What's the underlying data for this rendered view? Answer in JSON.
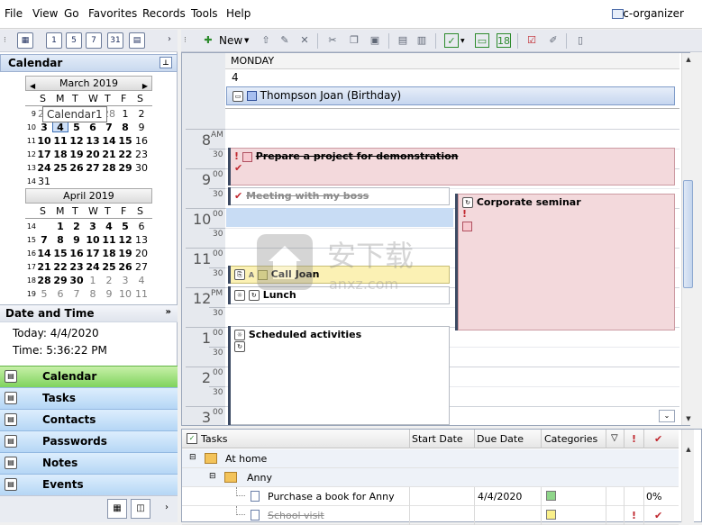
{
  "menu": {
    "file": "File",
    "view": "View",
    "go": "Go",
    "favorites": "Favorites",
    "records": "Records",
    "tools": "Tools",
    "help": "Help",
    "app_name": "c-organizer"
  },
  "left": {
    "header": "Calendar",
    "tooltip": "Calendar1",
    "march": {
      "title": "March 2019",
      "dow": [
        "S",
        "M",
        "T",
        "W",
        "T",
        "F",
        "S"
      ],
      "weeks": [
        {
          "wk": "9",
          "days": [
            "24",
            "25",
            "26",
            "27",
            "28",
            "1",
            "2"
          ]
        },
        {
          "wk": "10",
          "days": [
            "3",
            "4",
            "5",
            "6",
            "7",
            "8",
            "9"
          ]
        },
        {
          "wk": "11",
          "days": [
            "10",
            "11",
            "12",
            "13",
            "14",
            "15",
            "16"
          ]
        },
        {
          "wk": "12",
          "days": [
            "17",
            "18",
            "19",
            "20",
            "21",
            "22",
            "23"
          ]
        },
        {
          "wk": "13",
          "days": [
            "24",
            "25",
            "26",
            "27",
            "28",
            "29",
            "30"
          ]
        },
        {
          "wk": "14",
          "days": [
            "31"
          ]
        }
      ]
    },
    "april": {
      "title": "April 2019",
      "dow": [
        "S",
        "M",
        "T",
        "W",
        "T",
        "F",
        "S"
      ],
      "weeks": [
        {
          "wk": "14",
          "days": [
            "",
            "1",
            "2",
            "3",
            "4",
            "5",
            "6"
          ]
        },
        {
          "wk": "15",
          "days": [
            "7",
            "8",
            "9",
            "10",
            "11",
            "12",
            "13"
          ]
        },
        {
          "wk": "16",
          "days": [
            "14",
            "15",
            "16",
            "17",
            "18",
            "19",
            "20"
          ]
        },
        {
          "wk": "17",
          "days": [
            "21",
            "22",
            "23",
            "24",
            "25",
            "26",
            "27"
          ]
        },
        {
          "wk": "18",
          "days": [
            "28",
            "29",
            "30",
            "1",
            "2",
            "3",
            "4"
          ]
        },
        {
          "wk": "19",
          "days": [
            "5",
            "6",
            "7",
            "8",
            "9",
            "10",
            "11"
          ]
        }
      ]
    },
    "datetime_header": "Date and Time",
    "today": "Today: 4/4/2020",
    "time": "Time: 5:36:22 PM",
    "nav": [
      {
        "label": "Calendar",
        "icon": "calendar-icon"
      },
      {
        "label": "Tasks",
        "icon": "tasks-icon"
      },
      {
        "label": "Contacts",
        "icon": "contacts-icon"
      },
      {
        "label": "Passwords",
        "icon": "passwords-icon"
      },
      {
        "label": "Notes",
        "icon": "notes-icon"
      },
      {
        "label": "Events",
        "icon": "events-icon"
      }
    ]
  },
  "toolbar": {
    "new_label": "New"
  },
  "day": {
    "dayname": "MONDAY",
    "daynum": "4",
    "allday_event": "Thompson Joan (Birthday)",
    "hours": [
      {
        "h": "8",
        "ampm": "AM"
      },
      {
        "h": "9",
        "ampm": ""
      },
      {
        "h": "10",
        "ampm": ""
      },
      {
        "h": "11",
        "ampm": ""
      },
      {
        "h": "12",
        "ampm": "PM"
      },
      {
        "h": "1",
        "ampm": ""
      },
      {
        "h": "2",
        "ampm": ""
      },
      {
        "h": "3",
        "ampm": ""
      }
    ],
    "min_00": "00",
    "min_30": "30",
    "events": {
      "prepare": "Prepare a project for demonstration",
      "meeting": "Meeting with my boss",
      "seminar": "Corporate seminar",
      "call": "Call Joan",
      "lunch": "Lunch",
      "scheduled": "Scheduled activities"
    }
  },
  "tasks": {
    "columns": {
      "tasks": "Tasks",
      "start": "Start Date",
      "due": "Due Date",
      "categories": "Categories"
    },
    "group": "At home",
    "subgroup": "Anny",
    "rows": [
      {
        "name": "Purchase a book for Anny",
        "start": "",
        "due": "4/4/2020",
        "cat_color": "#8fd68a",
        "progress": "0%",
        "done": false
      },
      {
        "name": "School visit",
        "start": "",
        "due": "",
        "cat_color": "#faf08a",
        "progress": "",
        "done": true
      }
    ]
  }
}
